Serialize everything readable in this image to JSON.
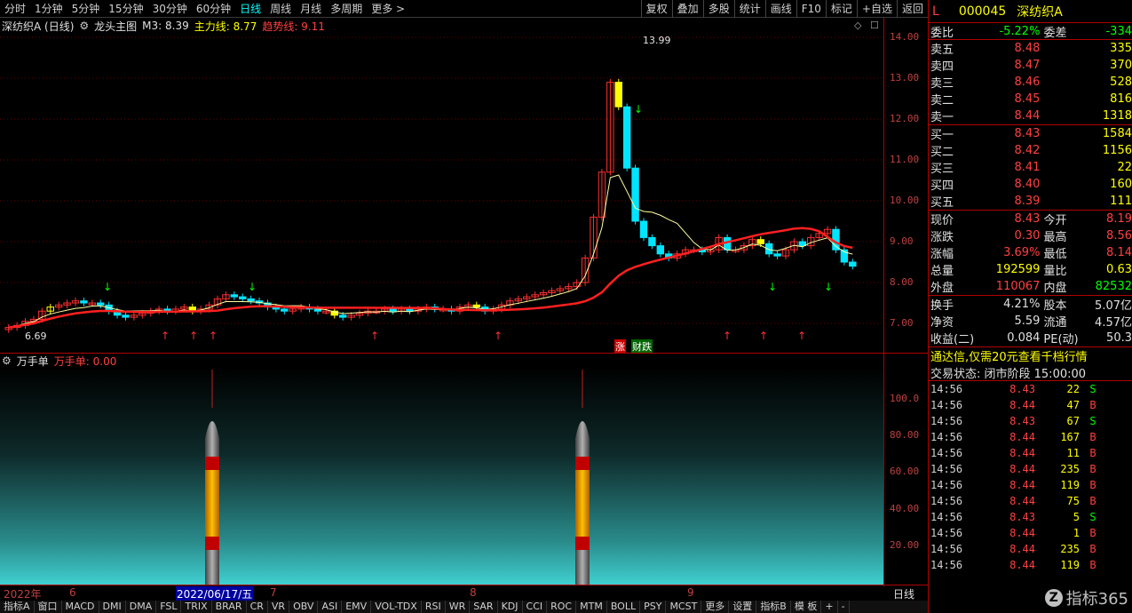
{
  "topbar": {
    "periods": [
      "分时",
      "1分钟",
      "5分钟",
      "15分钟",
      "30分钟",
      "60分钟",
      "日线",
      "周线",
      "月线",
      "多周期",
      "更多 >"
    ],
    "active": "日线",
    "tools": [
      "复权",
      "叠加",
      "多股",
      "统计",
      "画线",
      "F10",
      "标记",
      "+自选",
      "返回"
    ]
  },
  "info": {
    "name": "深纺织A (日线)",
    "main_icon": "gear-icon",
    "main_label": "龙头主图",
    "m3": "M3: 8.39",
    "zhuli": "主力线: 8.77",
    "qushi": "趋势线: 9.11"
  },
  "price_axis": [
    "14.00",
    "13.00",
    "12.00",
    "11.00",
    "10.00",
    "9.00",
    "8.00",
    "7.00"
  ],
  "ind_axis": [
    "100.0",
    "80.00",
    "60.00",
    "40.00",
    "20.00"
  ],
  "indicator": {
    "name": "万手单",
    "value": "万手单: 0.00"
  },
  "chart_labels": {
    "high": "13.99",
    "low": "6.69",
    "zhang": "涨",
    "caidie": "财跌"
  },
  "timebar": {
    "year": "2022年",
    "m6": "6",
    "date": "2022/06/17/五",
    "m7": "7",
    "m8": "8",
    "m9": "9",
    "right": "日线"
  },
  "tabs": [
    "指标A",
    "窗口",
    "MACD",
    "DMI",
    "DMA",
    "FSL",
    "TRIX",
    "BRAR",
    "CR",
    "VR",
    "OBV",
    "ASI",
    "EMV",
    "VOL-TDX",
    "RSI",
    "WR",
    "SAR",
    "KDJ",
    "CCI",
    "ROC",
    "MTM",
    "BOLL",
    "PSY",
    "MCST",
    "更多",
    "设置",
    "指标B",
    "模 板",
    "+",
    "-"
  ],
  "quote": {
    "flag": "L",
    "code": "000045",
    "name": "深纺织A",
    "weibi_label": "委比",
    "weibi": "-5.22%",
    "weicha_label": "委差",
    "weicha": "-334",
    "sell": [
      {
        "label": "卖五",
        "price": "8.48",
        "vol": "335"
      },
      {
        "label": "卖四",
        "price": "8.47",
        "vol": "370"
      },
      {
        "label": "卖三",
        "price": "8.46",
        "vol": "528"
      },
      {
        "label": "卖二",
        "price": "8.45",
        "vol": "816"
      },
      {
        "label": "卖一",
        "price": "8.44",
        "vol": "1318"
      }
    ],
    "buy": [
      {
        "label": "买一",
        "price": "8.43",
        "vol": "1584"
      },
      {
        "label": "买二",
        "price": "8.42",
        "vol": "1156"
      },
      {
        "label": "买三",
        "price": "8.41",
        "vol": "22"
      },
      {
        "label": "买四",
        "price": "8.40",
        "vol": "160"
      },
      {
        "label": "买五",
        "price": "8.39",
        "vol": "111"
      }
    ],
    "stats": [
      {
        "l1": "现价",
        "v1": "8.43",
        "l2": "今开",
        "v2": "8.19"
      },
      {
        "l1": "涨跌",
        "v1": "0.30",
        "l2": "最高",
        "v2": "8.56"
      },
      {
        "l1": "涨幅",
        "v1": "3.69%",
        "l2": "最低",
        "v2": "8.14"
      },
      {
        "l1": "总量",
        "v1": "192599",
        "l2": "量比",
        "v2": "0.63"
      },
      {
        "l1": "外盘",
        "v1": "110067",
        "l2": "内盘",
        "v2": "82532"
      }
    ],
    "stats2": [
      {
        "l1": "换手",
        "v1": "4.21%",
        "l2": "股本",
        "v2": "5.07亿"
      },
      {
        "l1": "净资",
        "v1": "5.59",
        "l2": "流通",
        "v2": "4.57亿"
      },
      {
        "l1": "收益(二)",
        "v1": "0.084",
        "l2": "PE(动)",
        "v2": "50.3"
      }
    ],
    "promo": "通达信,仅需20元查看千档行情",
    "status": "交易状态: 闭市阶段 15:00:00",
    "ticks": [
      {
        "t": "14:56",
        "p": "8.43",
        "v": "22",
        "s": "S"
      },
      {
        "t": "14:56",
        "p": "8.44",
        "v": "47",
        "s": "B"
      },
      {
        "t": "14:56",
        "p": "8.43",
        "v": "67",
        "s": "S"
      },
      {
        "t": "14:56",
        "p": "8.44",
        "v": "167",
        "s": "B"
      },
      {
        "t": "14:56",
        "p": "8.44",
        "v": "11",
        "s": "B"
      },
      {
        "t": "14:56",
        "p": "8.44",
        "v": "235",
        "s": "B"
      },
      {
        "t": "14:56",
        "p": "8.44",
        "v": "119",
        "s": "B"
      },
      {
        "t": "14:56",
        "p": "8.44",
        "v": "75",
        "s": "B"
      },
      {
        "t": "14:56",
        "p": "8.43",
        "v": "5",
        "s": "S"
      },
      {
        "t": "14:56",
        "p": "8.44",
        "v": "1",
        "s": "B"
      },
      {
        "t": "14:56",
        "p": "8.44",
        "v": "235",
        "s": "B"
      },
      {
        "t": "14:56",
        "p": "8.44",
        "v": "119",
        "s": "B"
      }
    ],
    "watermark": "指标365"
  }
}
